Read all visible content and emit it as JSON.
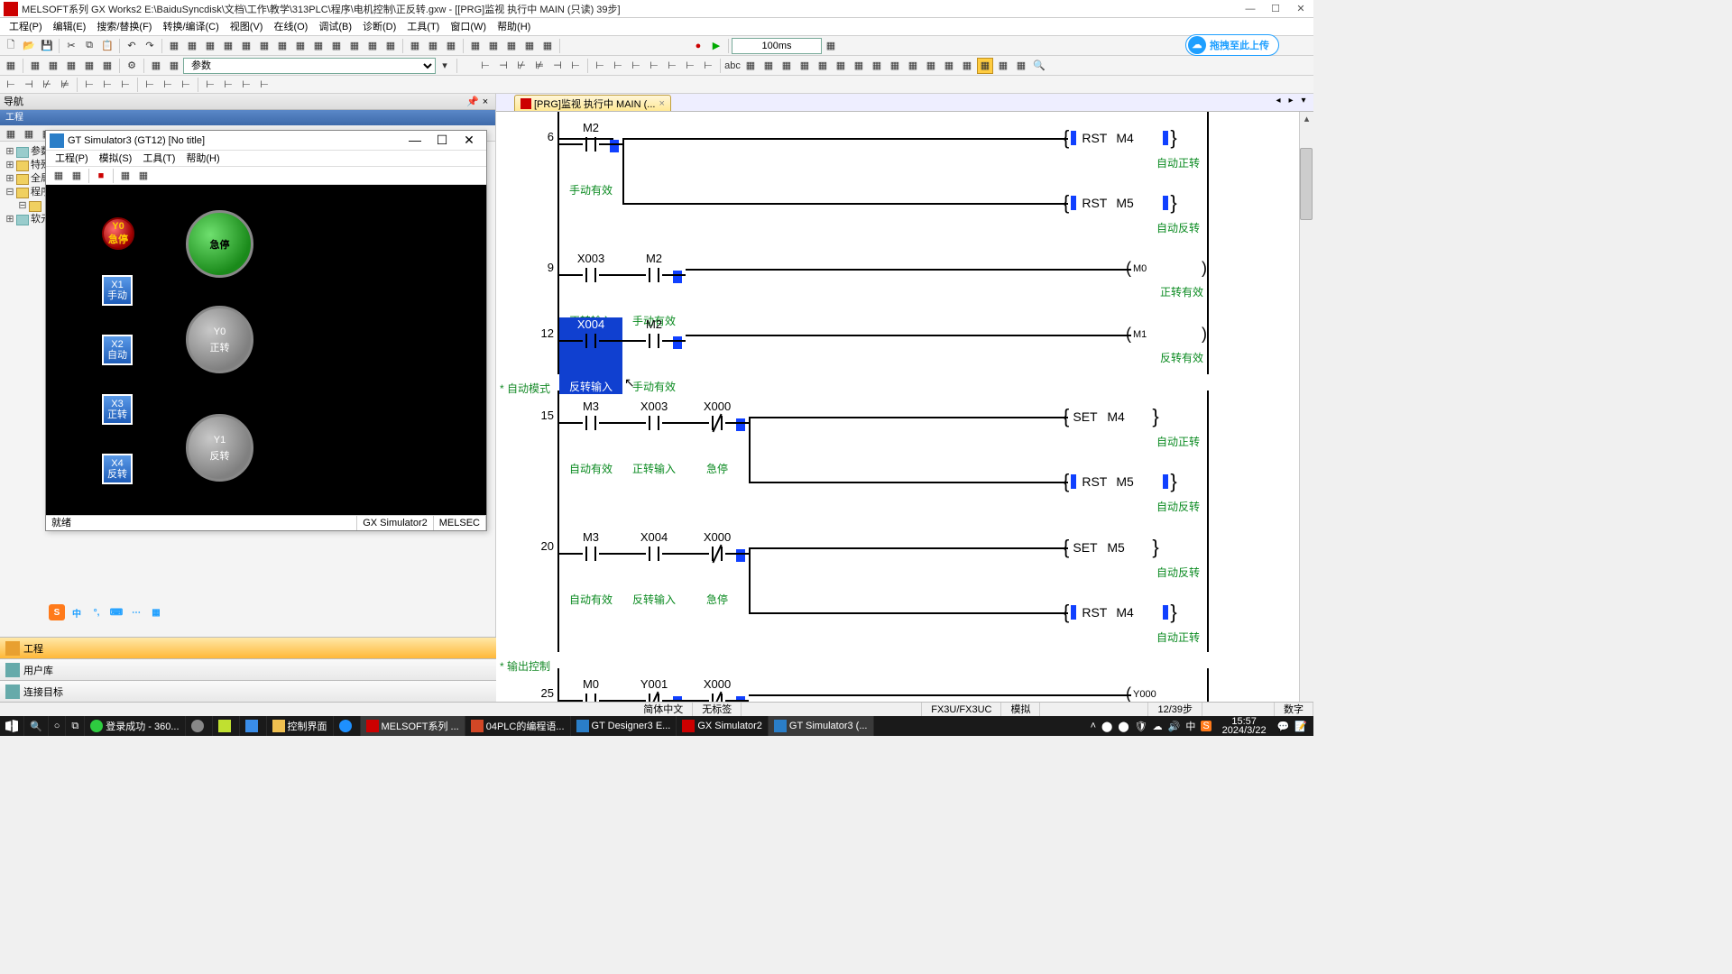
{
  "title": "MELSOFT系列 GX Works2 E:\\BaiduSyncdisk\\文档\\工作\\教学\\313PLC\\程序\\电机控制\\正反转.gxw - [[PRG]监视 执行中 MAIN (只读) 39步]",
  "menus": [
    "工程(P)",
    "编辑(E)",
    "搜索/替换(F)",
    "转换/编译(C)",
    "视图(V)",
    "在线(O)",
    "调试(B)",
    "诊断(D)",
    "工具(T)",
    "窗口(W)",
    "帮助(H)"
  ],
  "toolbar": {
    "timebase": "100ms",
    "param_select": "参数"
  },
  "upload_label": "拖拽至此上传",
  "nav": {
    "header": "导航",
    "sub": "工程",
    "tree": [
      "参数",
      "特殊",
      "全局",
      "程序",
      "软元"
    ]
  },
  "gt": {
    "title": "GT Simulator3 (GT12)  [No title]",
    "menus": [
      "工程(P)",
      "模拟(S)",
      "工具(T)",
      "帮助(H)"
    ],
    "status": {
      "ready": "就绪",
      "sim": "GX Simulator2",
      "type": "MELSEC"
    },
    "hmi": {
      "estop_small": "Y0\n急停",
      "estop_big": "急停",
      "y0": "Y0\n正转",
      "y1": "Y1\n反转",
      "x1": "X1\n手动",
      "x2": "X2\n自动",
      "x3": "X3\n正转",
      "x4": "X4\n反转"
    }
  },
  "tabs": {
    "active": "[PRG]监视 执行中 MAIN (..."
  },
  "left_nav": {
    "t1": "工程",
    "t2": "用户库",
    "t3": "连接目标"
  },
  "ladder": {
    "sec_auto": "* 自动模式",
    "sec_out": "* 输出控制",
    "r6": {
      "step": "6",
      "c1": {
        "addr": "M2",
        "cmt": "手动有效",
        "live": true
      },
      "o1": {
        "inst": "RST",
        "dev": "M4",
        "cmt": "自动正转",
        "live": true
      },
      "o2": {
        "inst": "RST",
        "dev": "M5",
        "cmt": "自动反转",
        "live": true
      }
    },
    "r9": {
      "step": "9",
      "c1": {
        "addr": "X003",
        "cmt": "正转输入"
      },
      "c2": {
        "addr": "M2",
        "cmt": "手动有效",
        "live": true
      },
      "o": {
        "dev": "M0",
        "cmt": "正转有效"
      }
    },
    "r12": {
      "step": "12",
      "c1": {
        "addr": "X004",
        "cmt": "反转输入",
        "sel": true
      },
      "c2": {
        "addr": "M2",
        "cmt": "手动有效",
        "live": true
      },
      "o": {
        "dev": "M1",
        "cmt": "反转有效"
      }
    },
    "r15": {
      "step": "15",
      "c1": {
        "addr": "M3",
        "cmt": "自动有效"
      },
      "c2": {
        "addr": "X003",
        "cmt": "正转输入"
      },
      "c3": {
        "addr": "X000",
        "cmt": "急停",
        "nc": true,
        "live": true
      },
      "o1": {
        "inst": "SET",
        "dev": "M4",
        "cmt": "自动正转"
      },
      "o2": {
        "inst": "RST",
        "dev": "M5",
        "cmt": "自动反转",
        "live": true
      }
    },
    "r20": {
      "step": "20",
      "c1": {
        "addr": "M3",
        "cmt": "自动有效"
      },
      "c2": {
        "addr": "X004",
        "cmt": "反转输入"
      },
      "c3": {
        "addr": "X000",
        "cmt": "急停",
        "nc": true,
        "live": true
      },
      "o1": {
        "inst": "SET",
        "dev": "M5",
        "cmt": "自动反转"
      },
      "o2": {
        "inst": "RST",
        "dev": "M4",
        "cmt": "自动正转",
        "live": true
      }
    },
    "r25": {
      "step": "25",
      "c1": {
        "addr": "M0",
        "cmt": ""
      },
      "c2": {
        "addr": "Y001",
        "cmt": "",
        "nc": true,
        "live": true
      },
      "c3": {
        "addr": "X000",
        "cmt": "",
        "nc": true,
        "live": true
      },
      "o": {
        "dev": "Y000",
        "cmt": ""
      }
    }
  },
  "status": {
    "lang": "简体中文",
    "tag": "无标签",
    "cpu": "FX3U/FX3UC",
    "mode": "模拟",
    "pos": "12/39步",
    "ovr": "数字"
  },
  "taskbar": {
    "items": [
      "登录成功 - 360...",
      "",
      "",
      "",
      "控制界面",
      "",
      "MELSOFT系列 ...",
      "04PLC的编程语...",
      "GT Designer3 E...",
      "GX Simulator2",
      "GT Simulator3 (..."
    ],
    "time": "15:57",
    "date": "2024/3/22"
  }
}
